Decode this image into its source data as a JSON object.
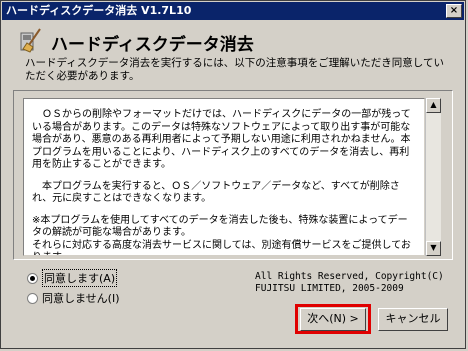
{
  "window": {
    "title": "ハードディスクデータ消去 V1.7L10",
    "close_symbol": "×"
  },
  "header": {
    "title": "ハードディスクデータ消去",
    "description": "ハードディスクデータ消去を実行するには、以下の注意事項をご理解いただき同意していただく必要があります。"
  },
  "notice": {
    "paragraphs": [
      "　ＯＳからの削除やフォーマットだけでは、ハードディスクにデータの一部が残っている場合があります。このデータは特殊なソフトウェアによって取り出す事が可能な場合があり、悪意のある再利用者によって予期しない用途に利用されかねません。本プログラムを用いることにより、ハードディスク上のすべてのデータを消去し、再利用を防止することができます。",
      "　本プログラムを実行すると、ＯＳ／ソフトウェア／データなど、すべてが削除され、元に戻すことはできなくなります。",
      "※本プログラムを使用してすべてのデータを消去した後も、特殊な装置によってデータの解読が可能な場合があります。\nそれらに対応する高度な消去サービスに関しては、別途有償サービスをご提供しております。"
    ]
  },
  "options": {
    "agree_label": "同意します(A)",
    "disagree_label": "同意しません(I)",
    "selected": "agree"
  },
  "copyright": {
    "line1": "All Rights Reserved, Copyright(C)",
    "line2": "FUJITSU LIMITED, 2005-2009"
  },
  "buttons": {
    "next_label": "次へ(N) >",
    "cancel_label": "キャンセル"
  },
  "colors": {
    "titlebar": "#0a246a",
    "highlight": "#e00000",
    "dialog_bg": "#d4d0c8"
  }
}
